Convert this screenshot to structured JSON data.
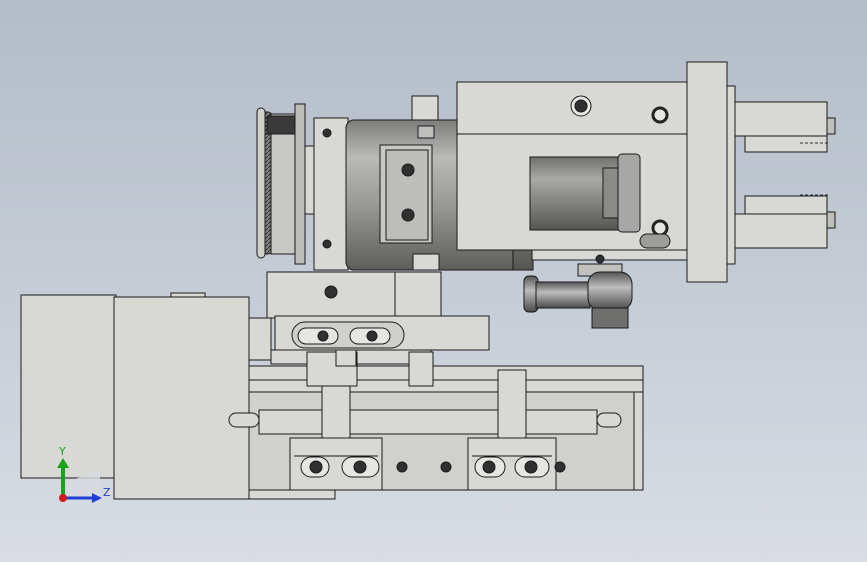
{
  "viewport": {
    "background_top": "#b3bcc8",
    "background_bottom": "#d9dde3"
  },
  "triad": {
    "y_label": "Y",
    "z_label": "Z",
    "y_color": "#1aa31a",
    "z_color": "#1f3fd6",
    "x_color": "#d11a1a"
  },
  "model": {
    "view": "right side view",
    "body_color": "#d8d8d5",
    "cylinder_color": "#9d9d9b",
    "edge_color": "#1a1a1a"
  }
}
